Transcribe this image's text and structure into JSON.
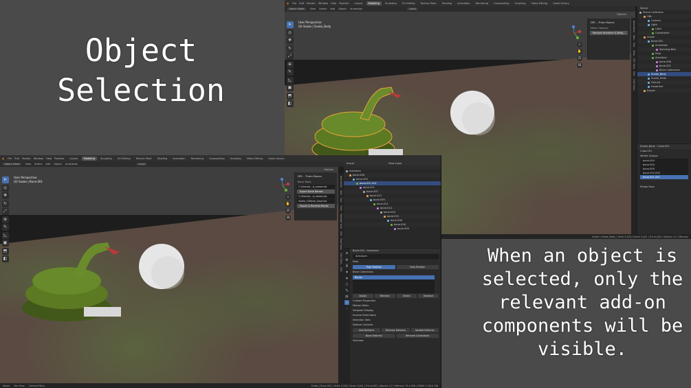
{
  "captions": {
    "title": "Object Selection",
    "description": "When an object is selected, only the relevant add-on components will be visible."
  },
  "menus": [
    "File",
    "Edit",
    "Render",
    "Window",
    "Help",
    "Pipeline"
  ],
  "workspaces": [
    "Layout",
    "Modeling",
    "Sculpting",
    "UV Editing",
    "Texture Paint",
    "Shading",
    "Animation",
    "Rendering",
    "Compositing",
    "Scripting",
    "Video Editing",
    "Asset Library"
  ],
  "active_workspace": "Modeling",
  "colors": {
    "accent": "#4772b3",
    "selection_outline": "#e8a33a",
    "snake": "#5b7a22"
  },
  "window1": {
    "mode": "Object Mode",
    "header_items": [
      "View",
      "Select",
      "Add",
      "Object",
      "Animation"
    ],
    "transform": "Local",
    "options": "Options",
    "view_name": "User Perspective",
    "collection": "(0) Snake | Snake_Body",
    "panel": {
      "title": "DPL - Them Bones",
      "mesh_cleanup_label": "Mesh Cleanup:",
      "remove_button": "Remove Armature & Weig..."
    },
    "side_tabs": [
      "Animation",
      "Item",
      "Tool",
      "View",
      "DPL Tools",
      "Edit",
      "OOO Tools"
    ],
    "scene_label": "Scene",
    "outliner": [
      {
        "label": "Scene Collection",
        "level": 0
      },
      {
        "label": "OBL",
        "level": 1
      },
      {
        "label": "Camera",
        "level": 2
      },
      {
        "label": "Light",
        "level": 2
      },
      {
        "label": "Light",
        "level": 3
      },
      {
        "label": "Constraints",
        "level": 3
      },
      {
        "label": "Snake",
        "level": 1
      },
      {
        "label": "Bone.001",
        "level": 2
      },
      {
        "label": "Animation",
        "level": 3
      },
      {
        "label": "Spinning Bite",
        "level": 4
      },
      {
        "label": "Pose",
        "level": 3
      },
      {
        "label": "Armature",
        "level": 3
      },
      {
        "label": "bone.008",
        "level": 4
      },
      {
        "label": "bone.001",
        "level": 4
      },
      {
        "label": "Bone Collections",
        "level": 4
      },
      {
        "label": "Snake_Body",
        "level": 2,
        "selected": true
      },
      {
        "label": "Snake_Teeth",
        "level": 2
      },
      {
        "label": "Ground",
        "level": 2
      },
      {
        "label": "Icosphere",
        "level": 2
      },
      {
        "label": "Export",
        "level": 1
      }
    ],
    "props_header": [
      "Snake_Body",
      "Cube.051"
    ],
    "mesh_name": "Cube.051",
    "vertex_groups_label": "Vertex Groups",
    "vertex_groups": [
      {
        "label": "bone.004",
        "selected": false
      },
      {
        "label": "bone.004",
        "selected": false
      },
      {
        "label": "bone.009",
        "selected": false
      },
      {
        "label": "bone.010.003",
        "selected": false
      },
      {
        "label": "bone.001.001",
        "selected": true
      }
    ],
    "shape_keys_label": "Shape Keys",
    "status": "Snake | Snake_Body | Verts 3,434 | Faces 3,441 | Tris 6,430 | Objects 1/7 | Memory"
  },
  "window2": {
    "mode": "Object Mode",
    "header_items": [
      "View",
      "Select",
      "Add",
      "Object",
      "Animation"
    ],
    "transform": "Local",
    "options": "Options",
    "view_name": "User Perspective",
    "collection": "(0) Snake | Bone.001",
    "panel": {
      "title": "DPL - Them Bones",
      "bone_tools_label": "Bone Tools:",
      "path1": "C:\\Users\\a...d_names.txt",
      "export_button": "Export Bone Names",
      "path2": "C:\\Users\\a...d_names.txt",
      "file_name": "Snake_23Bone_Good.txt",
      "import_button": "Import & Rename Bones"
    },
    "side_tabs": [
      "Animation",
      "Item",
      "Tool",
      "View",
      "Skeletal Tools",
      "Edit",
      "Pose Tools",
      "OOO Tools",
      "MRL"
    ],
    "scene_label": "Scene",
    "view_layer": "View Layer",
    "outliner": [
      {
        "label": "Armature",
        "level": 0
      },
      {
        "label": "bone.008",
        "level": 1
      },
      {
        "label": "bone.003",
        "level": 2
      },
      {
        "label": "bone.007.001",
        "level": 3,
        "selected": true
      },
      {
        "label": "bone.011",
        "level": 4
      },
      {
        "label": "bone.007",
        "level": 5
      },
      {
        "label": "bone.013",
        "level": 6
      },
      {
        "label": "bone.005",
        "level": 7
      },
      {
        "label": "bone.011",
        "level": 8
      },
      {
        "label": "bone.014",
        "level": 9
      },
      {
        "label": "bone.004",
        "level": 10
      },
      {
        "label": "bone.015",
        "level": 11
      },
      {
        "label": "bone.006",
        "level": 12
      },
      {
        "label": "bone.016",
        "level": 13
      },
      {
        "label": "bone.009",
        "level": 14
      }
    ],
    "props_header": [
      "Bone.001",
      "Armature"
    ],
    "armature_name": "Armature",
    "pose_label": "Pose",
    "pose_buttons": [
      "Pose Position",
      "Rest Position"
    ],
    "bone_collections_label": "Bone Collections",
    "bones_item": "Bones",
    "coll_buttons": [
      "Assign",
      "Remove",
      "Select",
      "Deselect"
    ],
    "sections": [
      "Custom Properties",
      "Motion Paths",
      "Viewport Display",
      "Inverse Kinematics",
      "Selection Sets",
      "Deform Controls"
    ],
    "deform_buttons": [
      "Add Deforms",
      "Remove Deforms",
      "Update Deforms"
    ],
    "deform_buttons2": [
      "Bone Deforms",
      "Rename Constraints"
    ],
    "selected_label": "Selected",
    "status_left": [
      "Select",
      "Pan View",
      "Context Menu"
    ],
    "status_right": "Snake | Bone.001 | Verts 3,434 | Faces 3,441 | Tris 6,430 | Objects 1/7 | Memory 75.4 MiB | VRAM 2.2/8.0 GiB"
  }
}
